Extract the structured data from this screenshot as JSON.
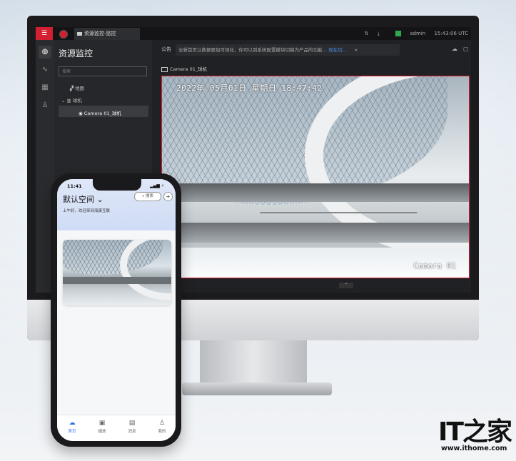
{
  "desktop": {
    "window_tab": "资源监控-监控",
    "user": "admin",
    "clock": "15:43:06 UTC",
    "sidebar": {
      "title": "资源监控",
      "search_placeholder": "搜索",
      "items": [
        {
          "label": "地图",
          "icon": "map-icon"
        },
        {
          "label": "球机",
          "icon": "building-icon"
        },
        {
          "label": "Camera 01_球机",
          "icon": "camera-icon"
        }
      ]
    },
    "notice": {
      "prefix": "公告",
      "text": "全新首页让数据更加可视化，你可以到系统配置模块切换为产品的功能…",
      "link": "现在切…",
      "close": "×"
    },
    "video": {
      "tab_label": "Camera 01_球机",
      "timestamp": "2022年 05月01日 星期日 18:47:42",
      "camera_overlay": "Camera 01"
    }
  },
  "phone": {
    "time": "11:41",
    "status": "▂▄▆ ⚡",
    "title": "默认空间",
    "search": "搜索",
    "greeting": "上午好，欢迎来到海康互联",
    "nav": [
      {
        "label": "首页",
        "icon": "home-icon",
        "active": true
      },
      {
        "label": "播放",
        "icon": "play-icon"
      },
      {
        "label": "消息",
        "icon": "message-icon"
      },
      {
        "label": "我的",
        "icon": "user-icon"
      }
    ]
  },
  "watermark": {
    "brand": "IT之家",
    "url": "www.ithome.com"
  },
  "colors": {
    "accent_red": "#d32030",
    "link_blue": "#4a8be8",
    "phone_active": "#2a6ef0"
  }
}
